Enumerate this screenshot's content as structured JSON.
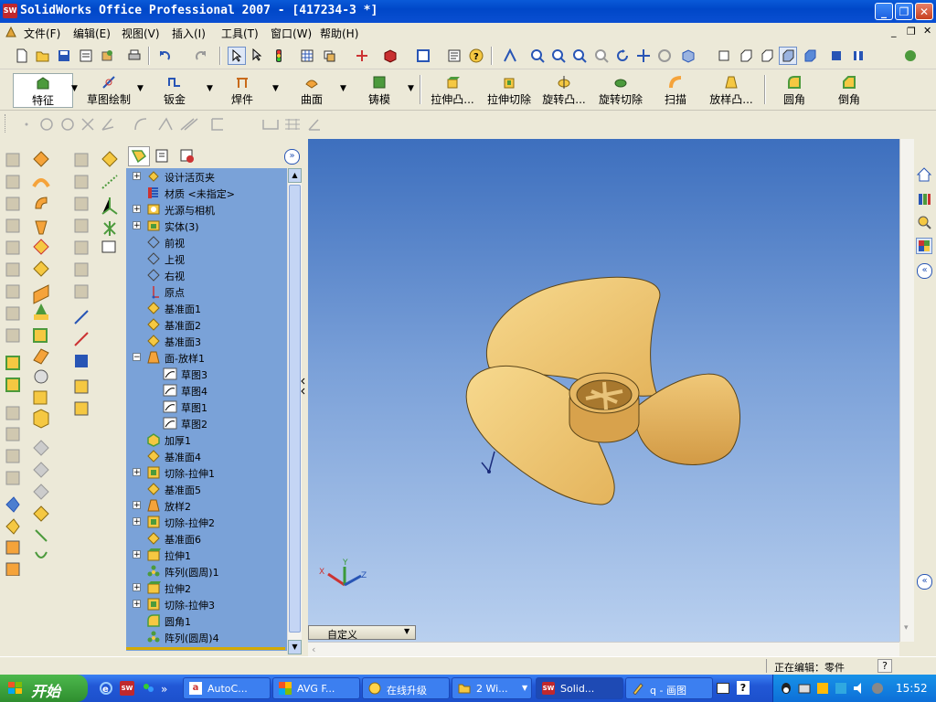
{
  "window": {
    "title": "SolidWorks Office Professional 2007 - [417234-3 *]",
    "logo_text": "SW"
  },
  "menu": [
    "文件(F)",
    "编辑(E)",
    "视图(V)",
    "插入(I)",
    "工具(T)",
    "窗口(W)",
    "帮助(H)"
  ],
  "command_manager": {
    "left_tabs": [
      "特征",
      "草图绘制",
      "钣金",
      "焊件",
      "曲面",
      "铸模"
    ],
    "commands": [
      "拉伸凸...",
      "拉伸切除",
      "旋转凸...",
      "旋转切除",
      "扫描",
      "放样凸...",
      "圆角",
      "倒角"
    ]
  },
  "feature_tree": [
    {
      "label": "设计活页夹",
      "icon": "binder-icon",
      "expand": "+",
      "sub": false
    },
    {
      "label": "材质 <未指定>",
      "icon": "material-icon",
      "expand": "",
      "sub": false
    },
    {
      "label": "光源与相机",
      "icon": "lights-icon",
      "expand": "+",
      "sub": false
    },
    {
      "label": "实体(3)",
      "icon": "solid-bodies-icon",
      "expand": "+",
      "sub": false
    },
    {
      "label": "前视",
      "icon": "plane-icon",
      "expand": "",
      "sub": false
    },
    {
      "label": "上视",
      "icon": "plane-icon",
      "expand": "",
      "sub": false
    },
    {
      "label": "右视",
      "icon": "plane-icon",
      "expand": "",
      "sub": false
    },
    {
      "label": "原点",
      "icon": "origin-icon",
      "expand": "",
      "sub": false
    },
    {
      "label": "基准面1",
      "icon": "ref-plane-icon",
      "expand": "",
      "sub": false
    },
    {
      "label": "基准面2",
      "icon": "ref-plane-icon",
      "expand": "",
      "sub": false
    },
    {
      "label": "基准面3",
      "icon": "ref-plane-icon",
      "expand": "",
      "sub": false
    },
    {
      "label": "面-放样1",
      "icon": "loft-icon",
      "expand": "−",
      "sub": false
    },
    {
      "label": "草图3",
      "icon": "sketch-icon",
      "expand": "",
      "sub": true
    },
    {
      "label": "草图4",
      "icon": "sketch-icon",
      "expand": "",
      "sub": true
    },
    {
      "label": "草图1",
      "icon": "sketch-icon",
      "expand": "",
      "sub": true
    },
    {
      "label": "草图2",
      "icon": "sketch-icon",
      "expand": "",
      "sub": true
    },
    {
      "label": "加厚1",
      "icon": "thicken-icon",
      "expand": "",
      "sub": false
    },
    {
      "label": "基准面4",
      "icon": "ref-plane-icon",
      "expand": "",
      "sub": false
    },
    {
      "label": "切除-拉伸1",
      "icon": "cut-extrude-icon",
      "expand": "+",
      "sub": false
    },
    {
      "label": "基准面5",
      "icon": "ref-plane-icon",
      "expand": "",
      "sub": false
    },
    {
      "label": "放样2",
      "icon": "loft-icon",
      "expand": "+",
      "sub": false
    },
    {
      "label": "切除-拉伸2",
      "icon": "cut-extrude-icon",
      "expand": "+",
      "sub": false
    },
    {
      "label": "基准面6",
      "icon": "ref-plane-icon",
      "expand": "",
      "sub": false
    },
    {
      "label": "拉伸1",
      "icon": "extrude-icon",
      "expand": "+",
      "sub": false
    },
    {
      "label": "阵列(圆周)1",
      "icon": "pattern-icon",
      "expand": "",
      "sub": false
    },
    {
      "label": "拉伸2",
      "icon": "extrude-icon",
      "expand": "+",
      "sub": false
    },
    {
      "label": "切除-拉伸3",
      "icon": "cut-extrude-icon",
      "expand": "+",
      "sub": false
    },
    {
      "label": "圆角1",
      "icon": "fillet-icon",
      "expand": "",
      "sub": false
    },
    {
      "label": "阵列(圆周)4",
      "icon": "pattern-icon",
      "expand": "",
      "sub": false
    }
  ],
  "viewport": {
    "view_orientation": "自定义"
  },
  "status": {
    "text": "正在编辑：零件"
  },
  "taskbar": {
    "start": "开始",
    "tasks": [
      "AutoC...",
      "AVG F...",
      "在线升级",
      "2 Wi...",
      "Solid...",
      "q - 画图"
    ],
    "clock": "15:52"
  },
  "colors": {
    "part": "#f2c975",
    "tree_bg": "#7aa2d8",
    "title_blue": "#0a5ad8"
  }
}
